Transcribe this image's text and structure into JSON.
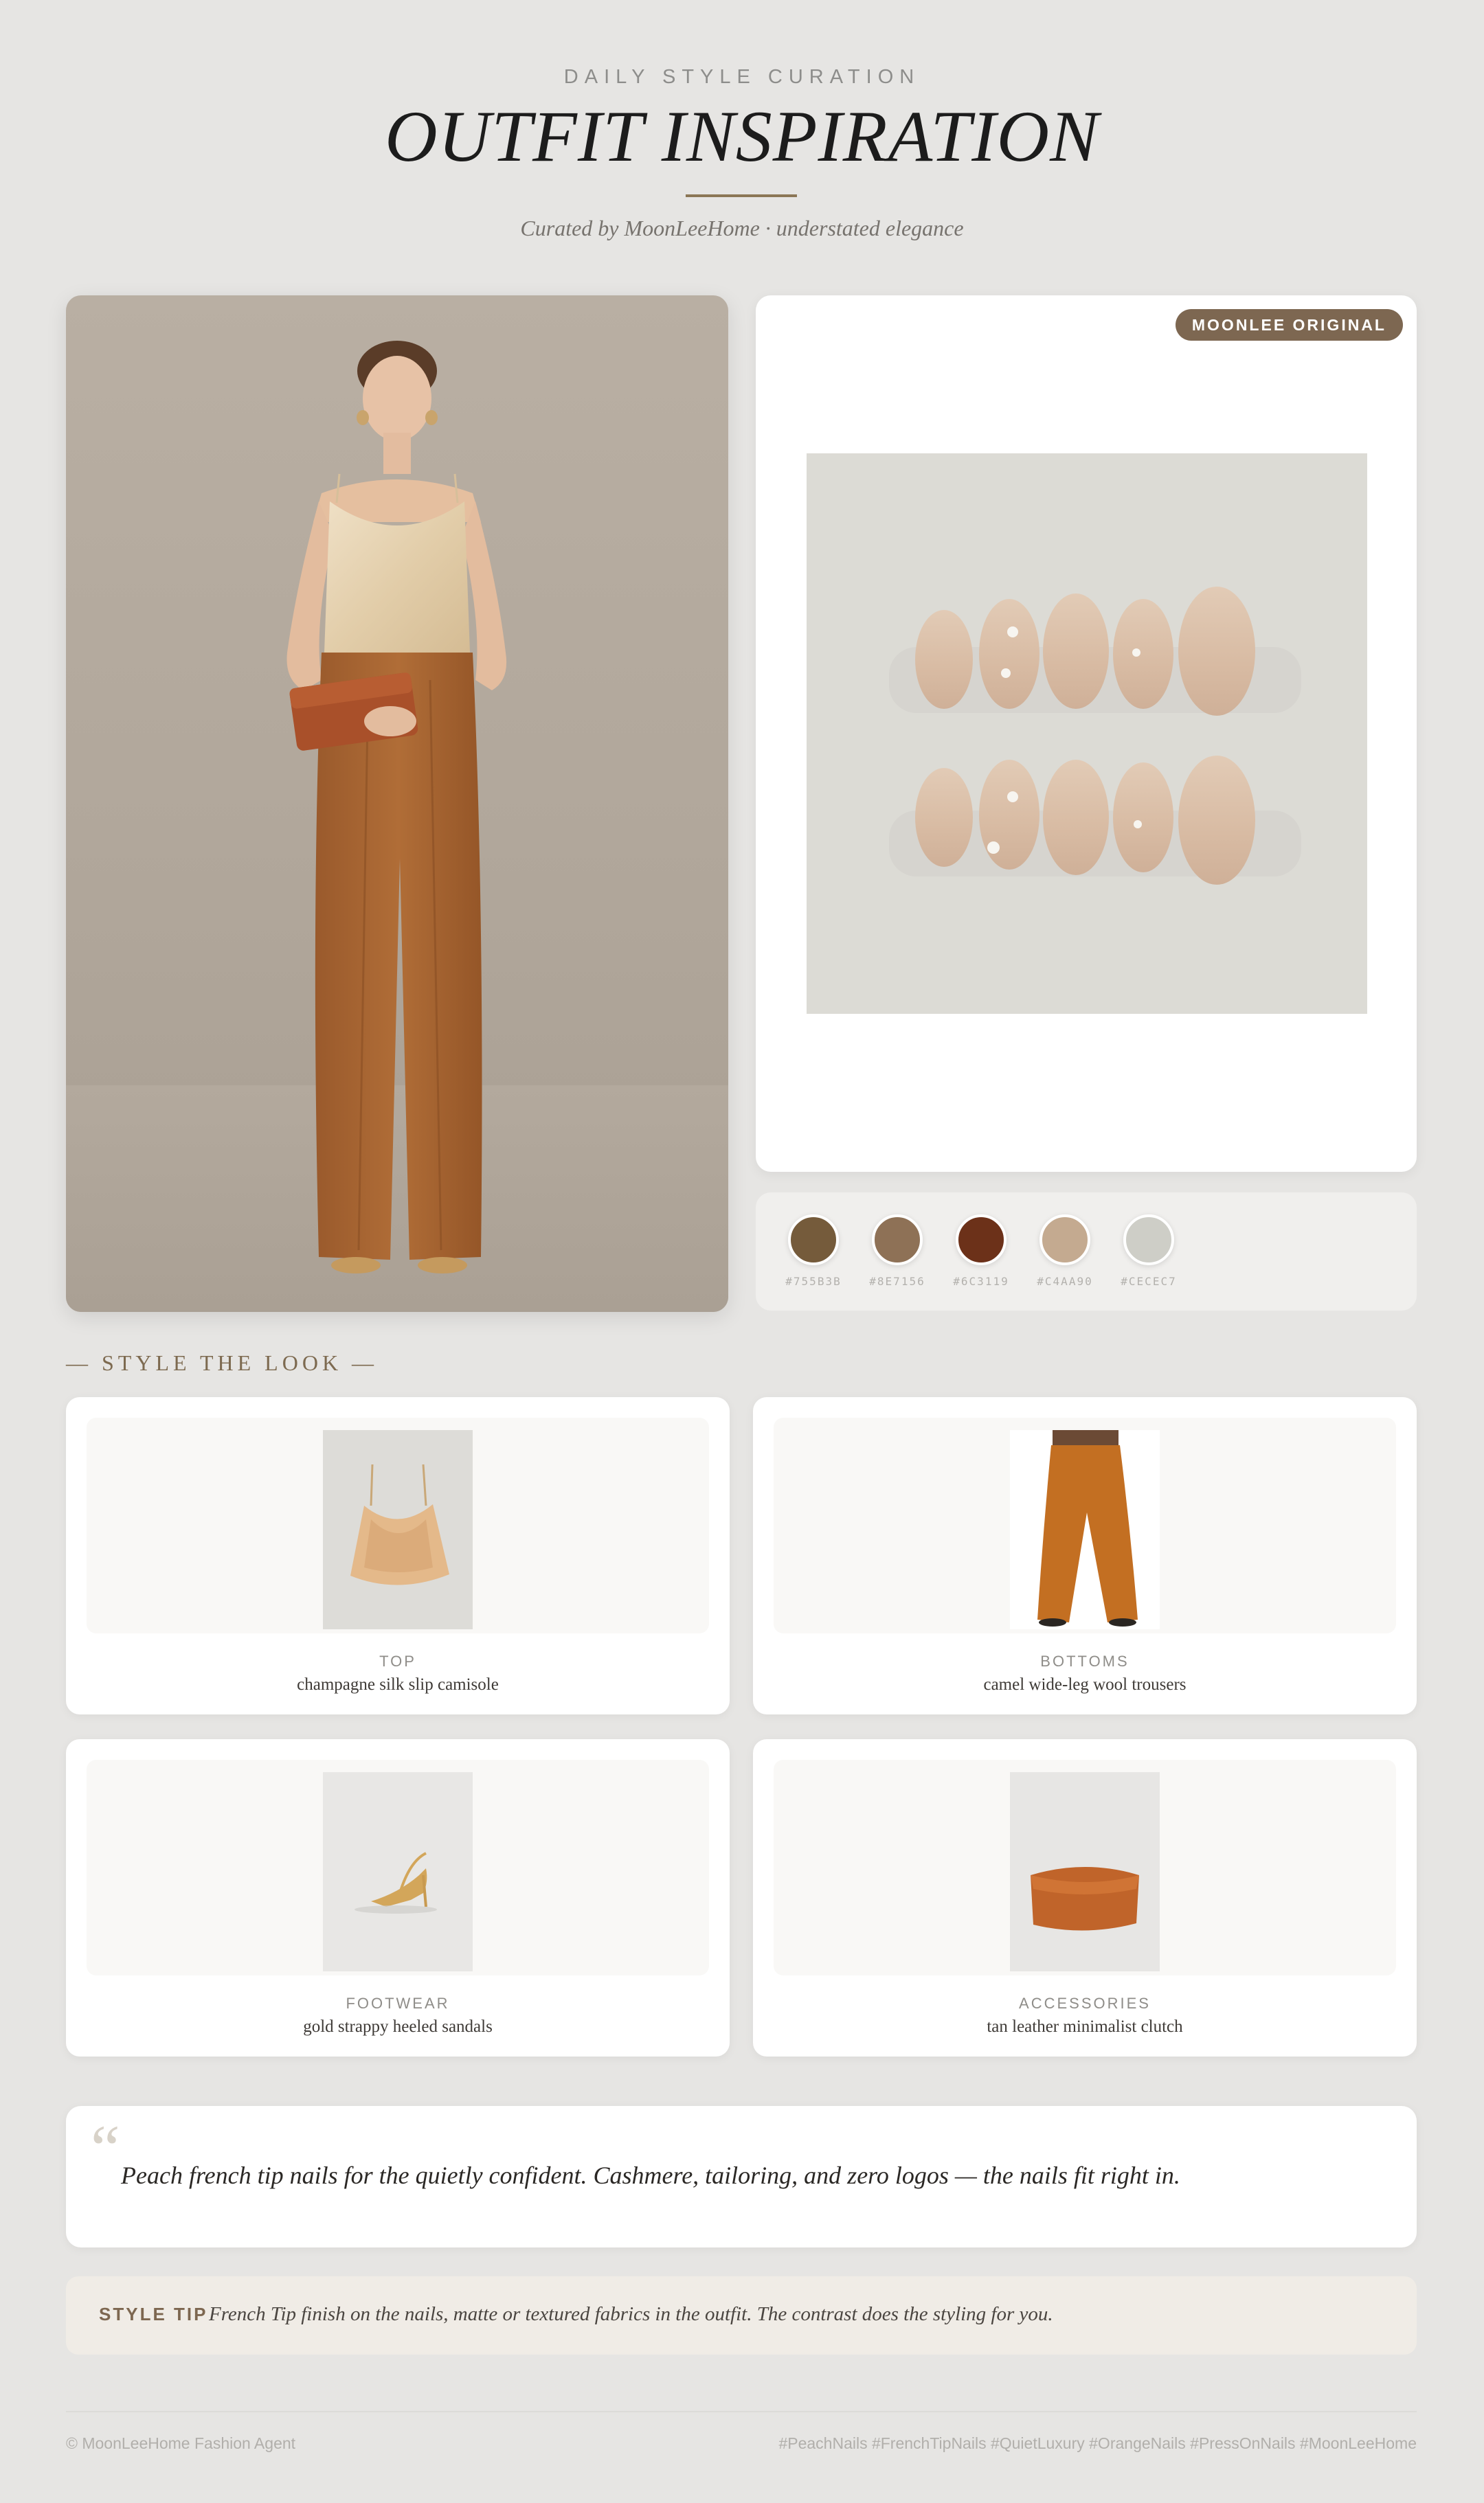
{
  "header": {
    "kicker": "DAILY STYLE CURATION",
    "title": "OUTFIT INSPIRATION",
    "subtitle": "Curated by MoonLeeHome · understated elegance"
  },
  "hero": {
    "icon": "model-outfit-photo"
  },
  "nails": {
    "badge": "MOONLEE ORIGINAL",
    "icon": "press-on-nails-photo"
  },
  "palette": [
    {
      "hex": "#755B3B",
      "label": "#755B3B"
    },
    {
      "hex": "#8E7156",
      "label": "#8E7156"
    },
    {
      "hex": "#6C3119",
      "label": "#6C3119"
    },
    {
      "hex": "#C4AA90",
      "label": "#C4AA90"
    },
    {
      "hex": "#CECEC7",
      "label": "#CECEC7"
    }
  ],
  "section": {
    "heading": "— STYLE THE LOOK —"
  },
  "items": [
    {
      "category": "TOP",
      "description": "champagne silk slip camisole",
      "icon": "camisole-icon"
    },
    {
      "category": "BOTTOMS",
      "description": "camel wide-leg wool trousers",
      "icon": "trousers-icon"
    },
    {
      "category": "FOOTWEAR",
      "description": "gold strappy heeled sandals",
      "icon": "sandal-icon"
    },
    {
      "category": "ACCESSORIES",
      "description": "tan leather minimalist clutch",
      "icon": "clutch-icon"
    }
  ],
  "quote": {
    "mark": "“",
    "text": "Peach french tip nails for the quietly confident. Cashmere, tailoring, and zero logos — the nails fit right in."
  },
  "tip": {
    "label": "STYLE TIP",
    "text": "French Tip finish on the nails, matte or textured fabrics in the outfit. The contrast does the styling for you."
  },
  "footer": {
    "left": "© MoonLeeHome Fashion Agent",
    "right": "#PeachNails #FrenchTipNails #QuietLuxury #OrangeNails #PressOnNails #MoonLeeHome"
  }
}
